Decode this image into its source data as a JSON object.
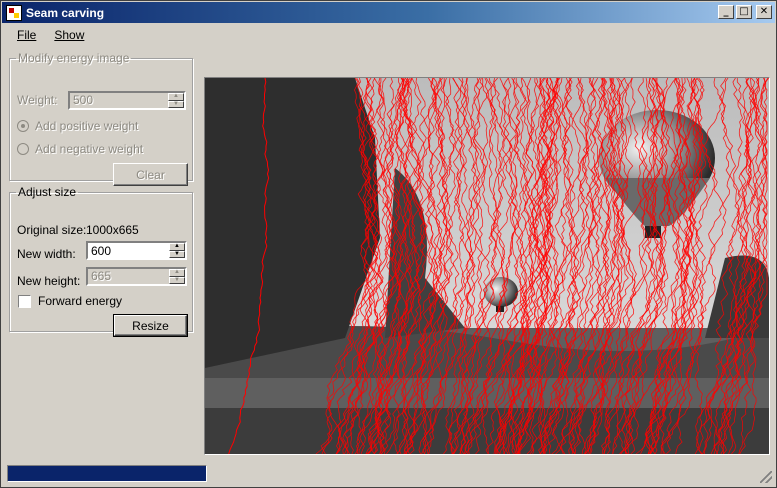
{
  "window": {
    "title": "Seam carving"
  },
  "title_buttons": {
    "minimize": "_",
    "maximize": "□",
    "close": "✕"
  },
  "menu": {
    "file": "File",
    "show": "Show"
  },
  "energy": {
    "legend": "Modify energy image",
    "weight_label": "Weight:",
    "weight_value": "500",
    "add_positive": "Add positive weight",
    "add_negative": "Add negative weight",
    "clear": "Clear"
  },
  "size": {
    "legend": "Adjust size",
    "original_label": "Original size:",
    "original_value": "1000x665",
    "new_width_label": "New width:",
    "new_width_value": "600",
    "new_height_label": "New height:",
    "new_height_value": "665",
    "forward_energy": "Forward energy",
    "resize": "Resize"
  },
  "progress": {
    "fraction": 1.0
  },
  "colors": {
    "seam": "#ff0000",
    "progress_fill": "#0a246a"
  }
}
